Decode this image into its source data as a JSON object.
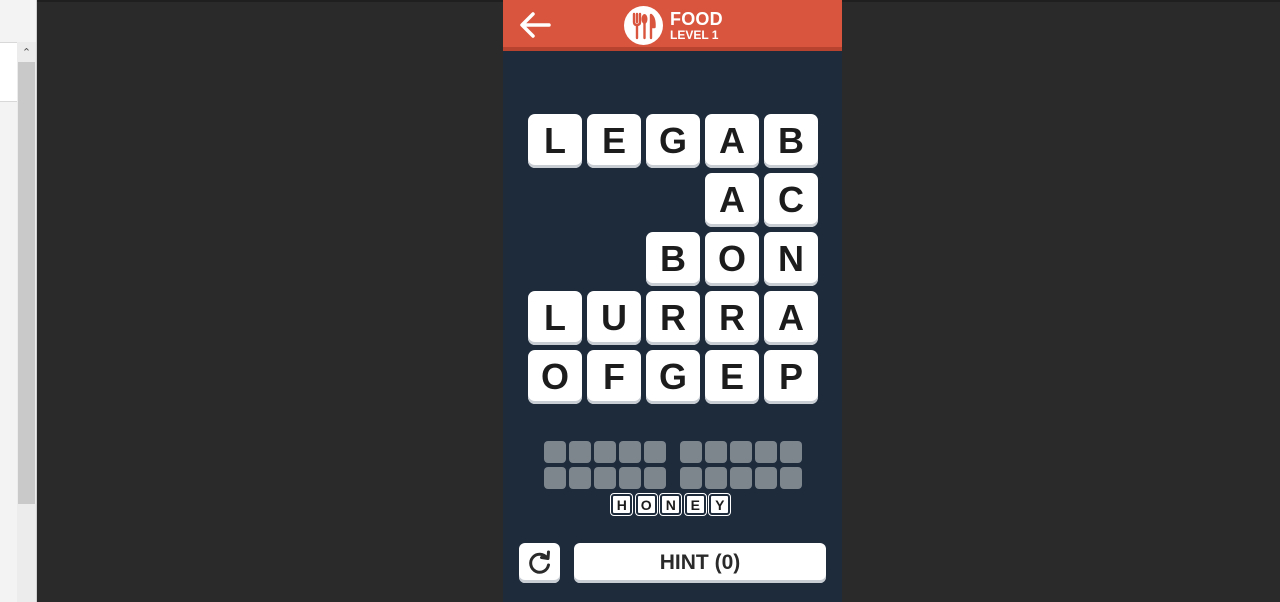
{
  "header": {
    "category": "FOOD",
    "level": "LEVEL 1",
    "back_icon": "arrow-left-icon",
    "category_icon": "cutlery-icon"
  },
  "grid": {
    "rows": [
      [
        "L",
        "E",
        "G",
        "A",
        "B"
      ],
      [
        "",
        "",
        "",
        "A",
        "C"
      ],
      [
        "",
        "",
        "B",
        "O",
        "N"
      ],
      [
        "L",
        "U",
        "R",
        "R",
        "A"
      ],
      [
        "O",
        "F",
        "G",
        "E",
        "P"
      ]
    ]
  },
  "answers": {
    "rows": [
      [
        5,
        5
      ],
      [
        5,
        5
      ]
    ]
  },
  "found_words": [
    "HONEY"
  ],
  "controls": {
    "reset_icon": "refresh-icon",
    "hint_label": "HINT (0)"
  },
  "colors": {
    "header": "#d9553d",
    "board": "#1e2b3b",
    "slot": "#7d858d",
    "tile": "#ffffff"
  }
}
